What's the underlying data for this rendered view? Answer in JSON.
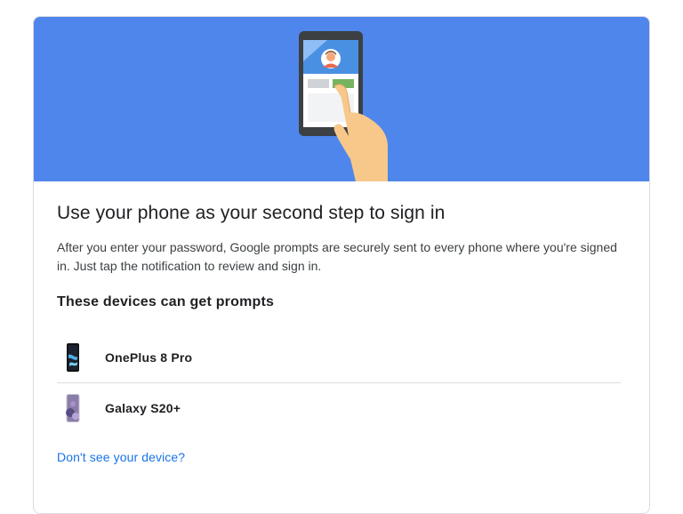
{
  "hero": {
    "illustration": "phone-tap-illustration",
    "background_color": "#4f86ec"
  },
  "main": {
    "title": "Use your phone as your second step to sign in",
    "description": "After you enter your password, Google prompts are securely sent to every phone where you're signed in. Just tap the notification to review and sign in.",
    "devices_heading": "These devices can get prompts",
    "devices": [
      {
        "name": "OnePlus 8 Pro",
        "icon": "oneplus-phone-icon"
      },
      {
        "name": "Galaxy S20+",
        "icon": "galaxy-phone-icon"
      }
    ],
    "missing_device_link": "Don't see your device?",
    "link_color": "#1a73e8"
  }
}
